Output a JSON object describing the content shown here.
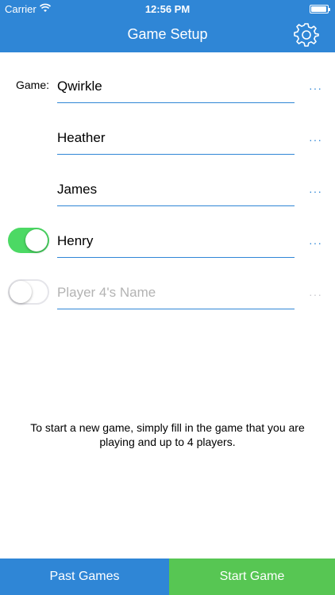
{
  "status_bar": {
    "carrier": "Carrier",
    "time": "12:56 PM"
  },
  "header": {
    "title": "Game Setup",
    "settings_icon": "gear-icon"
  },
  "form": {
    "game_label": "Game:",
    "game_value": "Qwirkle",
    "players": [
      {
        "value": "Heather",
        "placeholder": "",
        "toggle": null
      },
      {
        "value": "James",
        "placeholder": "",
        "toggle": null
      },
      {
        "value": "Henry",
        "placeholder": "",
        "toggle": true
      },
      {
        "value": "",
        "placeholder": "Player 4's Name",
        "toggle": false
      }
    ],
    "more_icon": "ellipsis-icon",
    "more_glyph": "···"
  },
  "instructions": "To start a new game, simply fill in the game that you are playing and up to 4 players.",
  "bottom": {
    "past_games": "Past Games",
    "start_game": "Start Game"
  },
  "colors": {
    "header": "#2f86d6",
    "toggle_on": "#4cd964",
    "start_button": "#57c653",
    "placeholder": "#b3b3b3"
  }
}
